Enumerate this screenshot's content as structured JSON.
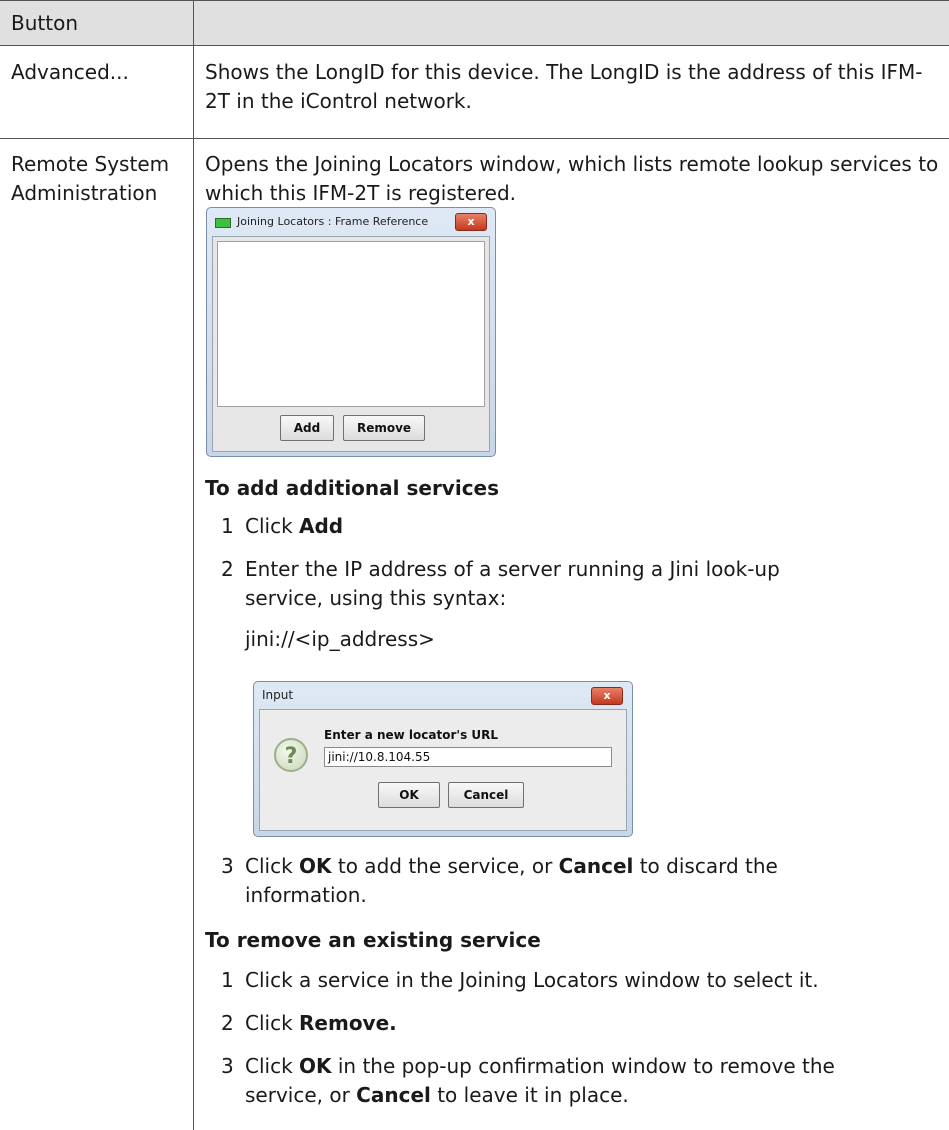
{
  "table": {
    "header": "Button",
    "rows": [
      {
        "name": "Advanced...",
        "description": "Shows the LongID for this device. The LongID is the address of this IFM-2T in the iControl network."
      },
      {
        "name_line1": "Remote System",
        "name_line2": "Administration",
        "description": "Opens the Joining Locators window, which lists remote lookup services to which this IFM-2T is registered."
      }
    ]
  },
  "joining_window": {
    "title": "Joining Locators : Frame Reference",
    "close_label": "x",
    "add_label": "Add",
    "remove_label": "Remove"
  },
  "add_section": {
    "heading": "To add additional services",
    "step1_prefix": "Click ",
    "step1_bold": "Add",
    "step2_line1": "Enter the IP address of a server running a Jini look-up",
    "step2_line2": "service, using this syntax:",
    "syntax": "jini://<ip_address>",
    "step3_prefix": "Click ",
    "step3_bold1": "OK",
    "step3_mid": " to add the service, or ",
    "step3_bold2": "Cancel",
    "step3_suffix": " to discard the",
    "step3_line2": "information."
  },
  "input_dialog": {
    "title": "Input",
    "close_label": "x",
    "prompt": "Enter a new locator's URL",
    "value": "jini://10.8.104.55",
    "ok_label": "OK",
    "cancel_label": "Cancel"
  },
  "remove_section": {
    "heading": "To remove an existing service",
    "step1": "Click a service in the Joining Locators window to select it.",
    "step2_prefix": "Click ",
    "step2_bold": "Remove.",
    "step3_prefix": "Click ",
    "step3_bold1": "OK",
    "step3_mid": " in the pop-up confirmation window to remove the",
    "step3_line2_prefix": "service, or ",
    "step3_bold2": "Cancel",
    "step3_line2_suffix": " to leave it in place."
  },
  "step_numbers": [
    "1",
    "2",
    "3"
  ]
}
